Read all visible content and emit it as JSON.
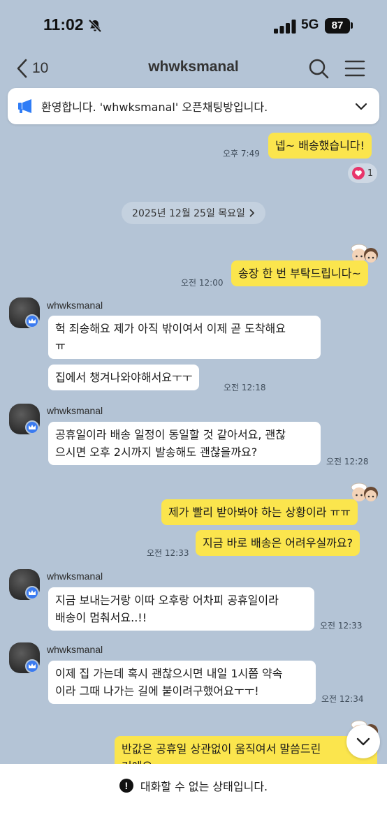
{
  "status_bar": {
    "time": "11:02",
    "network": "5G",
    "battery": "87"
  },
  "header": {
    "back_count": "10",
    "title": "whwksmanal"
  },
  "notice": {
    "text": "환영합니다. 'whwksmanal' 오픈채팅방입니다."
  },
  "messages": {
    "m1": {
      "text": "넵~ 배송했습니다!",
      "time": "오후 7:49"
    },
    "m1_reaction": {
      "count": "1"
    },
    "date_divider": "2025년 12월 25일 목요일",
    "m2": {
      "text": "송장 한 번 부탁드립니다~",
      "time": "오전 12:00"
    },
    "g1": {
      "sender": "whwksmanal",
      "line1": "헉 죄송해요 제가 아직 밖이여서 이제 곧 도착해요",
      "line2": "ㅠ",
      "text2": "집에서 챙겨나와야해서요ㅜㅜ",
      "time": "오전 12:18"
    },
    "g2": {
      "sender": "whwksmanal",
      "line1": "공휴일이라 배송 일정이 동일할 것 같아서요, 괜찮",
      "line2": "으시면 오후 2시까지 발송해도 괜찮을까요?",
      "time": "오전 12:28"
    },
    "m3": {
      "text1": "제가 빨리 받아봐야 하는 상황이라 ㅠㅠ",
      "text2": "지금 바로 배송은 어려우실까요?",
      "time": "오전 12:33"
    },
    "g3": {
      "sender": "whwksmanal",
      "line1": "지금 보내는거랑 이따 오후랑 어차피 공휴일이라",
      "line2": "배송이 멈춰서요..!!",
      "time": "오전 12:33"
    },
    "g4": {
      "sender": "whwksmanal",
      "line1": "이제 집 가는데 혹시 괜찮으시면 내일 1시쯤 약속",
      "line2": "이라 그때 나가는 길에 붙이려구했어요ㅜㅜ!",
      "time": "오전 12:34"
    },
    "m4": {
      "line1": "반값은 공휴일 상관없이 움직여서 말씀드린",
      "line2": "거에요"
    }
  },
  "footer": {
    "text": "대화할 수 없는 상태입니다."
  },
  "colors": {
    "background": "#b4c4d6",
    "my_bubble": "#fbe54d",
    "other_bubble": "#ffffff",
    "badge": "#3b7bf0"
  }
}
